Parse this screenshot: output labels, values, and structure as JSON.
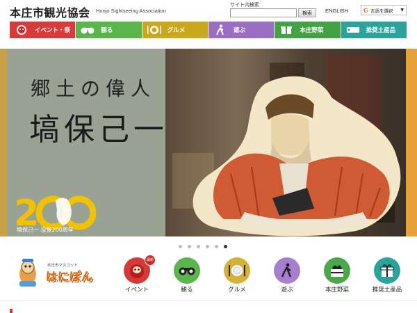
{
  "header": {
    "title": "本庄市観光協会",
    "subtitle": "Honjo Sightseeing Association",
    "search_label": "サイト内検索",
    "search_value": "",
    "search_button": "検索",
    "english_link": "ENGLISH",
    "translate": {
      "brand": "G",
      "label": "言語を選択",
      "caret": "▼"
    }
  },
  "nav": {
    "items": [
      {
        "label": "イベント・祭",
        "color": "#d93a3a",
        "icon": "dharma-icon"
      },
      {
        "label": "観る",
        "color": "#5ab64a",
        "icon": "binoculars-icon"
      },
      {
        "label": "グルメ",
        "color": "#c9a81c",
        "icon": "plate-icon"
      },
      {
        "label": "遊ぶ",
        "color": "#9b6ec4",
        "icon": "walker-icon"
      },
      {
        "label": "本庄野菜",
        "color": "#43a244",
        "icon": "gift-icon"
      },
      {
        "label": "推奨土産品",
        "color": "#2aa39a",
        "icon": "ticket-icon"
      }
    ]
  },
  "hero": {
    "heading_line1": "郷土の偉人",
    "heading_line2": "塙保己一",
    "anniversary_number": "200",
    "anniversary_caption": "塙保己一 没後200周年",
    "slides": 6,
    "active_slide": 6
  },
  "mascot": {
    "small_label": "本庄市マスコット",
    "name": "はにぽん"
  },
  "categories": [
    {
      "label": "イベント",
      "color": "#d6393a",
      "icon": "dharma-icon",
      "badge": "最新"
    },
    {
      "label": "観る",
      "color": "#5ab64a",
      "icon": "binoculars-icon"
    },
    {
      "label": "グルメ",
      "color": "#d4b23a",
      "icon": "plate-icon"
    },
    {
      "label": "遊ぶ",
      "color": "#a77fd0",
      "icon": "walker-icon"
    },
    {
      "label": "本庄野菜",
      "color": "#4aa84a",
      "icon": "vegetable-icon"
    },
    {
      "label": "推奨土産品",
      "color": "#2aa39a",
      "icon": "gift-icon"
    }
  ]
}
